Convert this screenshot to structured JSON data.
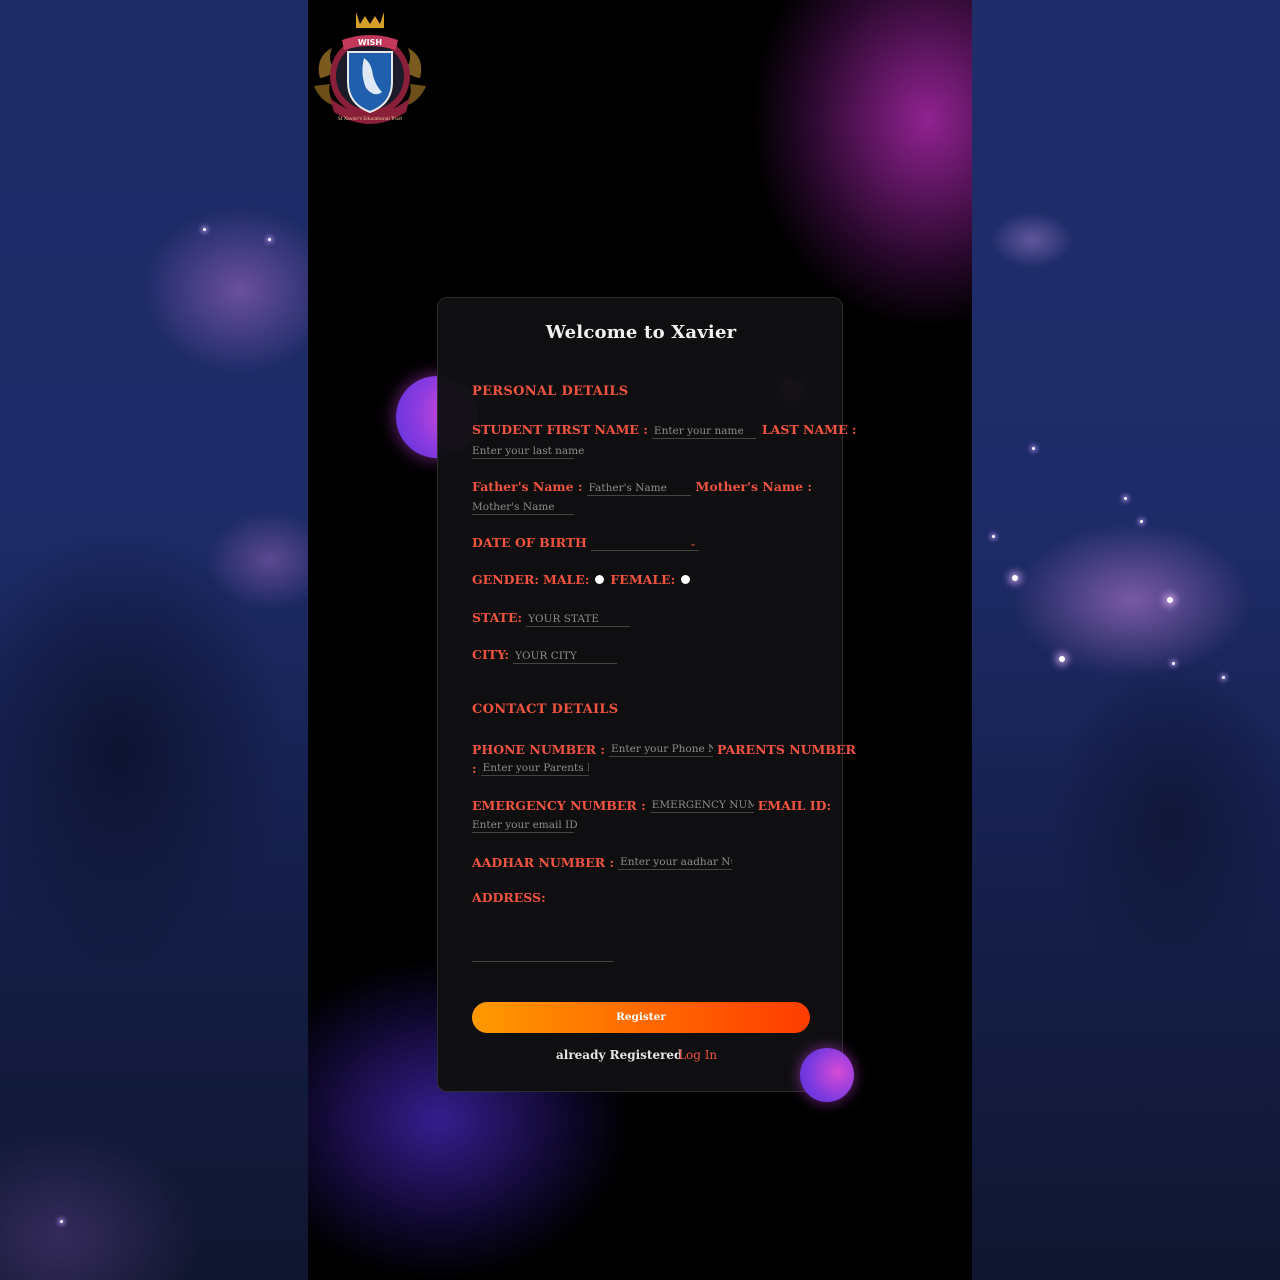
{
  "logo": {
    "text": "WISH",
    "subtext": "St Xavier's Educational Trust"
  },
  "form": {
    "title": "Welcome to Xavier",
    "personal": {
      "heading": "PERSONAL DETAILS",
      "first_name_label": "STUDENT FIRST NAME :",
      "first_name_placeholder": "Enter your name",
      "last_name_label": "LAST NAME :",
      "last_name_placeholder": "Enter your last name",
      "father_label": "Father's Name :",
      "father_placeholder": "Father's Name",
      "mother_label": "Mother's Name :",
      "mother_placeholder": "Mother's Name",
      "dob_label": "DATE OF BIRTH",
      "gender_label": "GENDER:",
      "male_label": "MALE:",
      "female_label": "FEMALE:",
      "state_label": "STATE:",
      "state_placeholder": "YOUR STATE",
      "city_label": "CITY:",
      "city_placeholder": "YOUR CITY"
    },
    "contact": {
      "heading": "CONTACT DETAILS",
      "phone_label": "PHONE NUMBER :",
      "phone_placeholder": "Enter your Phone Nun",
      "parents_label": "PARENTS NUMBER",
      "parents_colon": ":",
      "parents_placeholder": "Enter your Parents Nur",
      "emergency_label": "EMERGENCY NUMBER :",
      "emergency_placeholder": "EMERGENCY NUME",
      "email_label": "EMAIL ID:",
      "email_placeholder": "Enter your email ID",
      "aadhar_label": "AADHAR NUMBER :",
      "aadhar_placeholder": "Enter your aadhar Numb",
      "address_label": "ADDRESS:"
    },
    "register_button": "Register",
    "already_text": "already Registered",
    "login_link": "Log In"
  },
  "colors": {
    "label": "#f0533f",
    "button_start": "#ff9a00",
    "button_end": "#ff3c00",
    "card_bg": "#101012"
  }
}
